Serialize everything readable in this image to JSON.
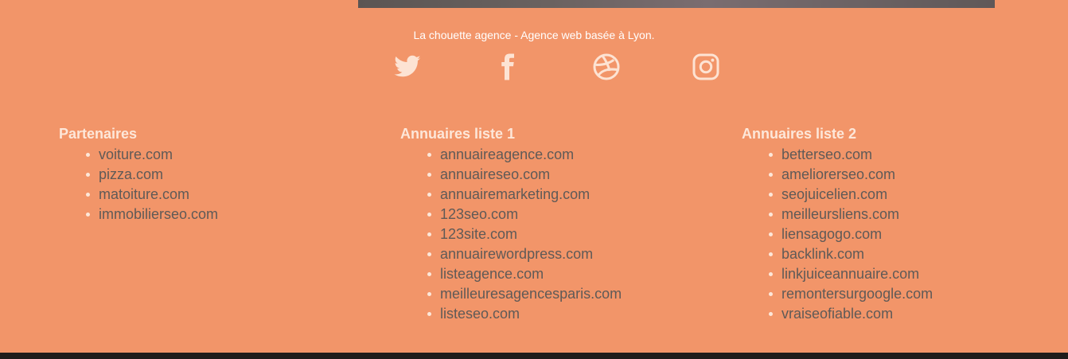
{
  "footer": {
    "tagline": "La chouette agence - Agence web basée à Lyon.",
    "socials": [
      {
        "icon": "twitter-icon"
      },
      {
        "icon": "facebook-icon"
      },
      {
        "icon": "dribbble-icon"
      },
      {
        "icon": "instagram-icon"
      }
    ],
    "columns": [
      {
        "title": "Partenaires",
        "links": [
          "voiture.com",
          "pizza.com",
          "matoiture.com",
          "immobilierseo.com"
        ]
      },
      {
        "title": "Annuaires liste 1",
        "links": [
          "annuaireagence.com",
          "annuaireseo.com",
          "annuairemarketing.com",
          "123seo.com",
          "123site.com",
          "annuairewordpress.com",
          "listeagence.com",
          "meilleuresagencesparis.com",
          "listeseo.com"
        ]
      },
      {
        "title": "Annuaires liste 2",
        "links": [
          "betterseo.com",
          "ameliorerseo.com",
          "seojuicelien.com",
          "meilleursliens.com",
          "liensagogo.com",
          "backlink.com",
          "linkjuiceannuaire.com",
          "remontersurgoogle.com",
          "vraiseofiable.com"
        ]
      }
    ]
  },
  "colors": {
    "footer_bg": "#f29569",
    "icon_color": "#fde3d3",
    "link_color": "#5f5a57",
    "heading_color": "#fde7d9",
    "bottom_bar": "#1f1d1c"
  }
}
